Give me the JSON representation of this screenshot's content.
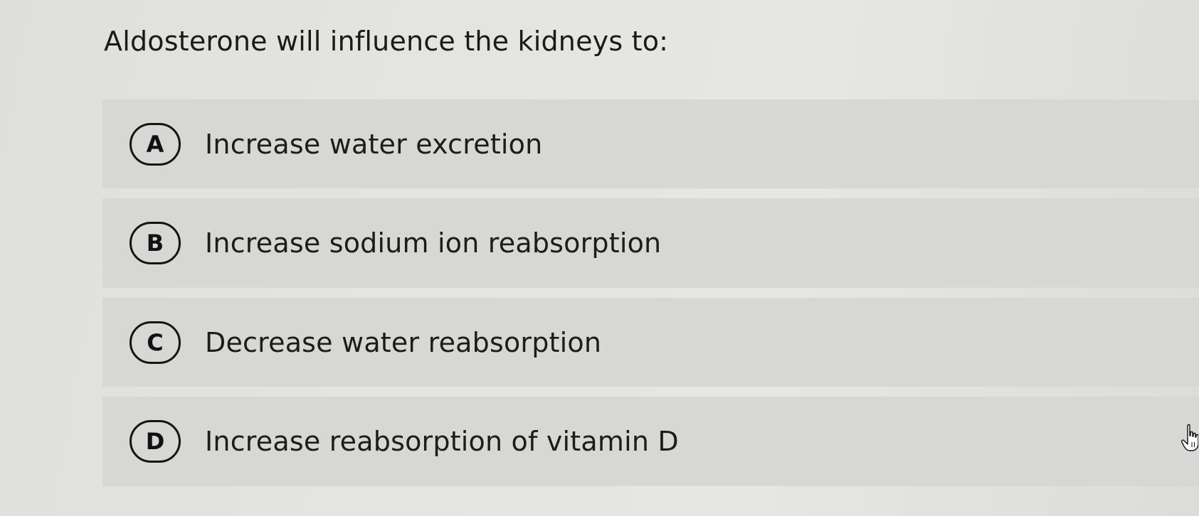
{
  "question": {
    "text": "Aldosterone will influence the kidneys to:"
  },
  "choices": [
    {
      "letter": "A",
      "text": "Increase water excretion"
    },
    {
      "letter": "B",
      "text": "Increase sodium ion reabsorption"
    },
    {
      "letter": "C",
      "text": "Decrease water reabsorption"
    },
    {
      "letter": "D",
      "text": "Increase reabsorption of vitamin D"
    }
  ],
  "icons": {
    "cursor": "hand-pointer-icon"
  }
}
